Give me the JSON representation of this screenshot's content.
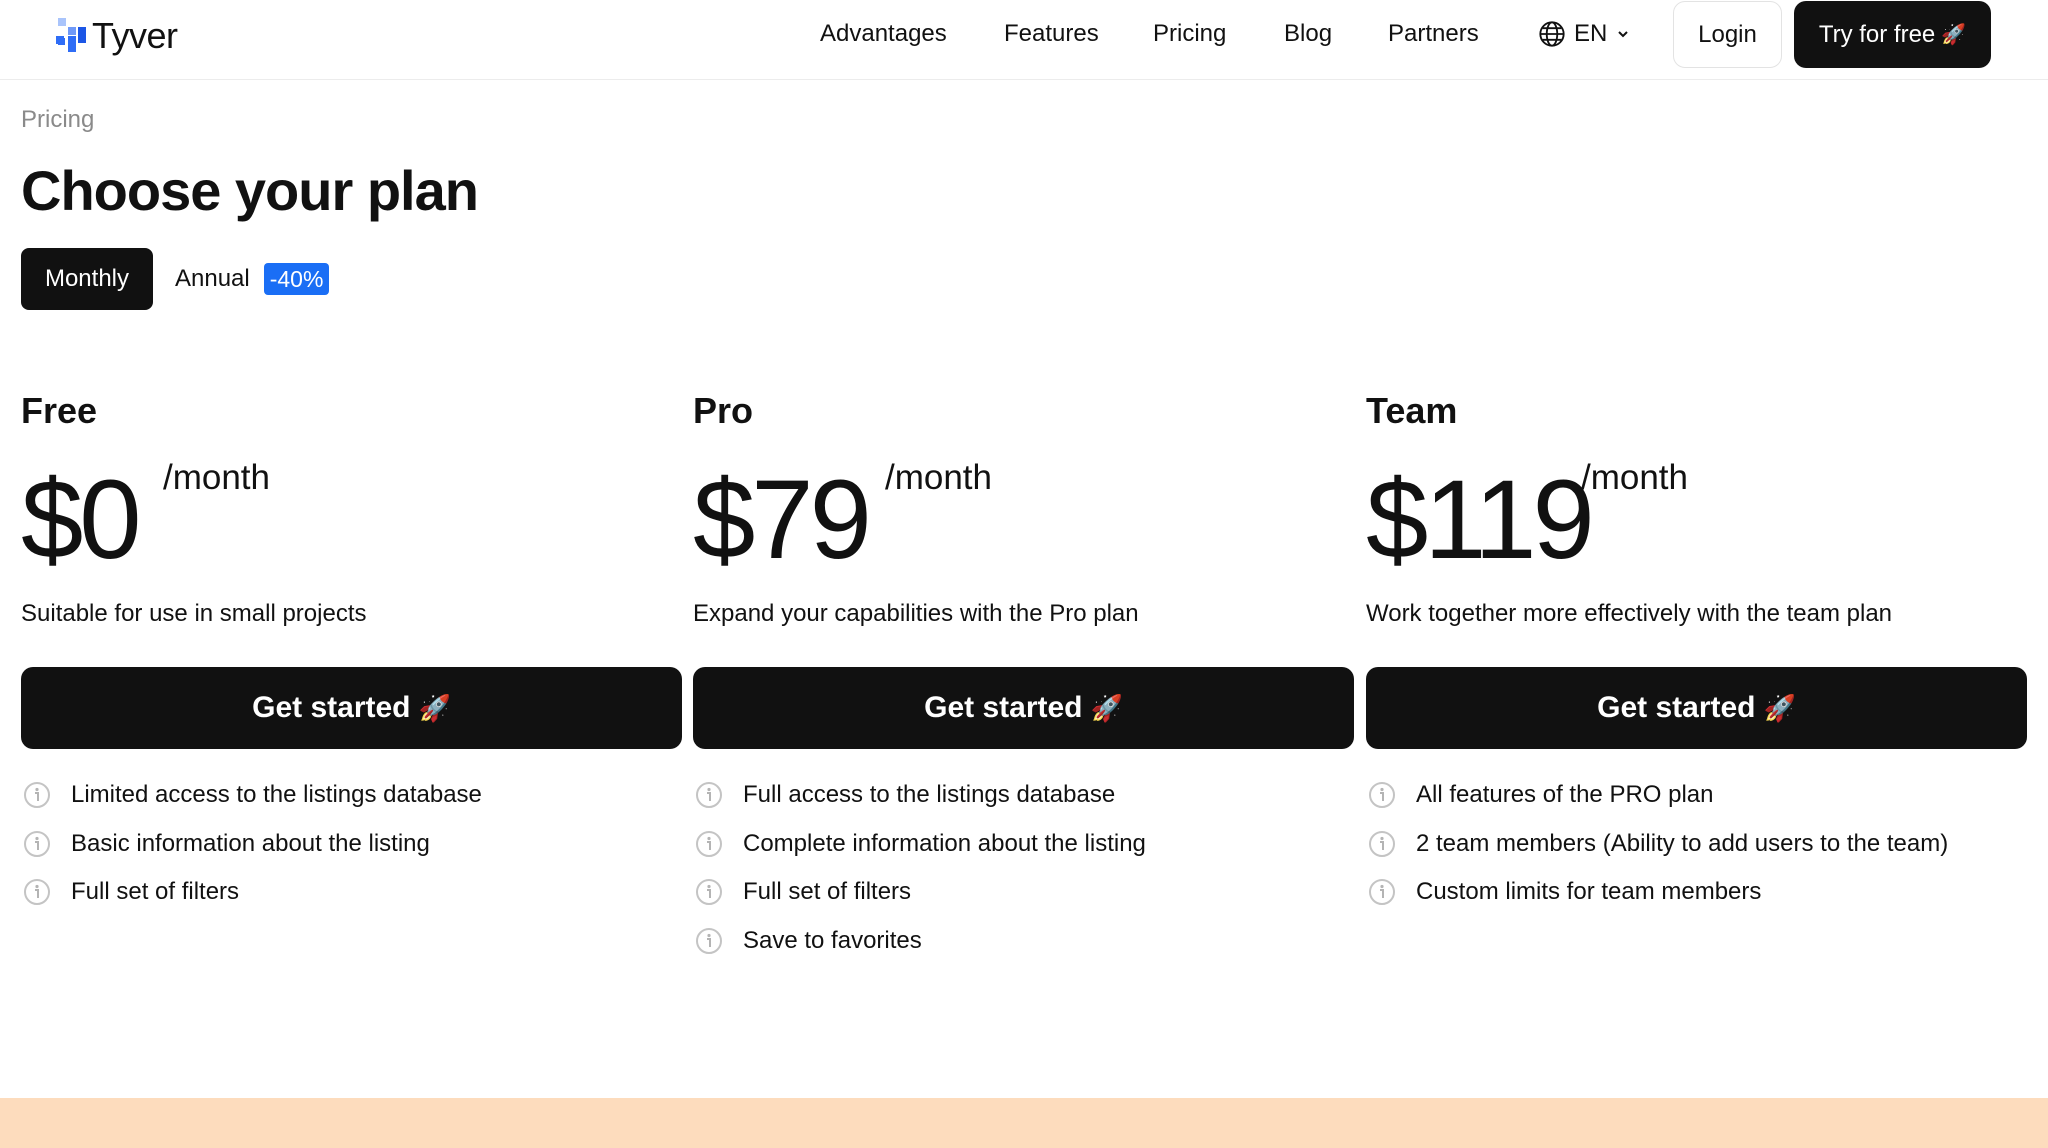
{
  "header": {
    "logo_text": "Tyver",
    "nav": [
      "Advantages",
      "Features",
      "Pricing",
      "Blog",
      "Partners"
    ],
    "language": "EN",
    "login_label": "Login",
    "try_label": "Try for free",
    "try_emoji": "🚀"
  },
  "page": {
    "breadcrumb": "Pricing",
    "title": "Choose your plan",
    "billing": {
      "monthly_label": "Monthly",
      "annual_label": "Annual",
      "annual_discount": "-40%",
      "selected": "Monthly"
    }
  },
  "plans": [
    {
      "name": "Free",
      "price": "$0",
      "period": "/month",
      "description": "Suitable for use in small projects",
      "cta": "Get started",
      "features": [
        "Limited access to the listings database",
        "Basic information about the listing",
        "Full set of filters"
      ]
    },
    {
      "name": "Pro",
      "price": "$79",
      "period": "/month",
      "description": "Expand your capabilities with the Pro plan",
      "cta": "Get started",
      "features": [
        "Full access to the listings database",
        "Complete information about the listing",
        "Full set of filters",
        "Save to favorites"
      ]
    },
    {
      "name": "Team",
      "price": "$119",
      "period": "/month",
      "description": "Work together more effectively with the team plan",
      "cta": "Get started",
      "features": [
        "All features of the PRO plan",
        "2 team members (Ability to add users to the team)",
        "Custom limits for team members"
      ]
    }
  ],
  "colors": {
    "primary_dark": "#111111",
    "badge_blue": "#1a6ef5",
    "footer_band": "#fddcbd",
    "logo_blue": "#2f6df6"
  },
  "icons": {
    "language": "globe-icon",
    "dropdown": "chevron-down-icon",
    "feature_info": "info-icon",
    "cta": "rocket-icon"
  }
}
